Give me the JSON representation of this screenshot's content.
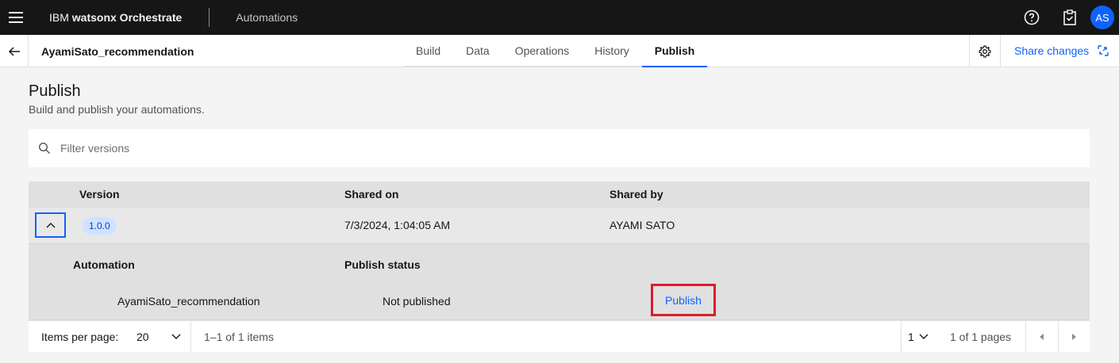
{
  "header": {
    "brand_prefix": "IBM ",
    "brand_name": "watsonx Orchestrate",
    "section": "Automations",
    "avatar_initials": "AS"
  },
  "subbar": {
    "project_name": "AyamiSato_recommendation",
    "tabs": [
      {
        "label": "Build",
        "active": false
      },
      {
        "label": "Data",
        "active": false
      },
      {
        "label": "Operations",
        "active": false
      },
      {
        "label": "History",
        "active": false
      },
      {
        "label": "Publish",
        "active": true
      }
    ],
    "share_label": "Share changes"
  },
  "page": {
    "title": "Publish",
    "subtitle": "Build and publish your automations."
  },
  "search": {
    "placeholder": "Filter versions"
  },
  "table": {
    "headers": {
      "version": "Version",
      "shared_on": "Shared on",
      "shared_by": "Shared by"
    },
    "rows": [
      {
        "version": "1.0.0",
        "shared_on": "7/3/2024, 1:04:05 AM",
        "shared_by": "AYAMI SATO"
      }
    ],
    "detail": {
      "automation_label": "Automation",
      "status_label": "Publish status",
      "automation_name": "AyamiSato_recommendation",
      "status_value": "Not published",
      "publish_action": "Publish"
    }
  },
  "pagination": {
    "items_per_page_label": "Items per page:",
    "items_per_page": "20",
    "range_text": "1–1 of 1 items",
    "current_page": "1",
    "pages_text": "1 of 1 pages"
  },
  "colors": {
    "primary": "#0f62fe",
    "highlight": "#da1e28",
    "tag_bg": "#d0e2ff"
  }
}
